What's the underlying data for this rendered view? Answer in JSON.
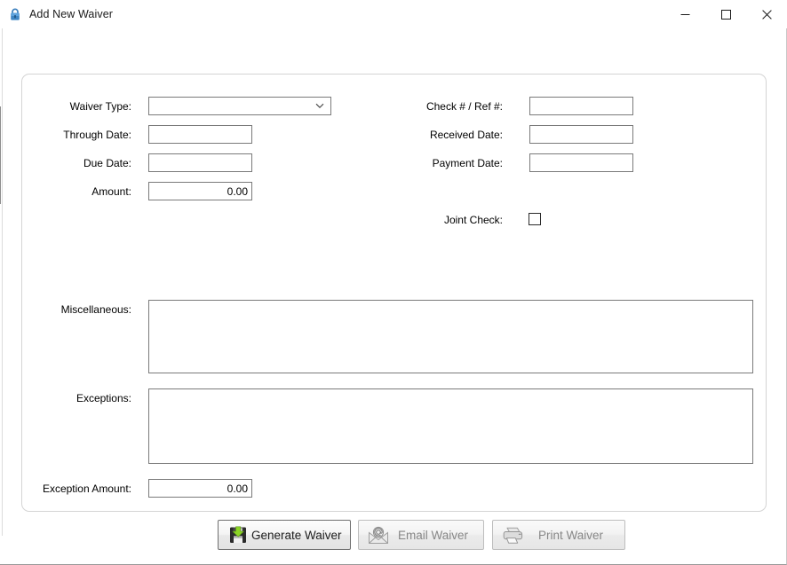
{
  "window": {
    "title": "Add New Waiver",
    "icon": "lock-icon",
    "controls": {
      "minimize": "minimize-icon",
      "maximize": "maximize-icon",
      "close": "close-icon"
    }
  },
  "form": {
    "left": {
      "waiver_type": {
        "label": "Waiver Type:",
        "value": "",
        "icon": "chevron-down-icon"
      },
      "through_date": {
        "label": "Through Date:",
        "value": ""
      },
      "due_date": {
        "label": "Due Date:",
        "value": ""
      },
      "amount": {
        "label": "Amount:",
        "value": "0.00"
      }
    },
    "right": {
      "check_ref": {
        "label": "Check # / Ref #:",
        "value": ""
      },
      "received_date": {
        "label": "Received Date:",
        "value": ""
      },
      "payment_date": {
        "label": "Payment Date:",
        "value": ""
      },
      "joint_check": {
        "label": "Joint Check:",
        "checked": false
      }
    },
    "misc": {
      "label": "Miscellaneous:",
      "value": ""
    },
    "exceptions": {
      "label": "Exceptions:",
      "value": ""
    },
    "exception_amount": {
      "label": "Exception Amount:",
      "value": "0.00"
    }
  },
  "buttons": {
    "generate": {
      "label": "Generate Waiver",
      "icon": "save-floppy-icon",
      "enabled": true
    },
    "email": {
      "label": "Email Waiver",
      "icon": "email-envelope-icon",
      "enabled": false
    },
    "print": {
      "label": "Print Waiver",
      "icon": "printer-icon",
      "enabled": false
    }
  },
  "colors": {
    "accent_lock": "#2f6fa8",
    "save_arrow": "#7cc220",
    "field_border": "#7a7a7a",
    "panel_border": "#d4d4d4",
    "disabled_text": "#878787"
  }
}
